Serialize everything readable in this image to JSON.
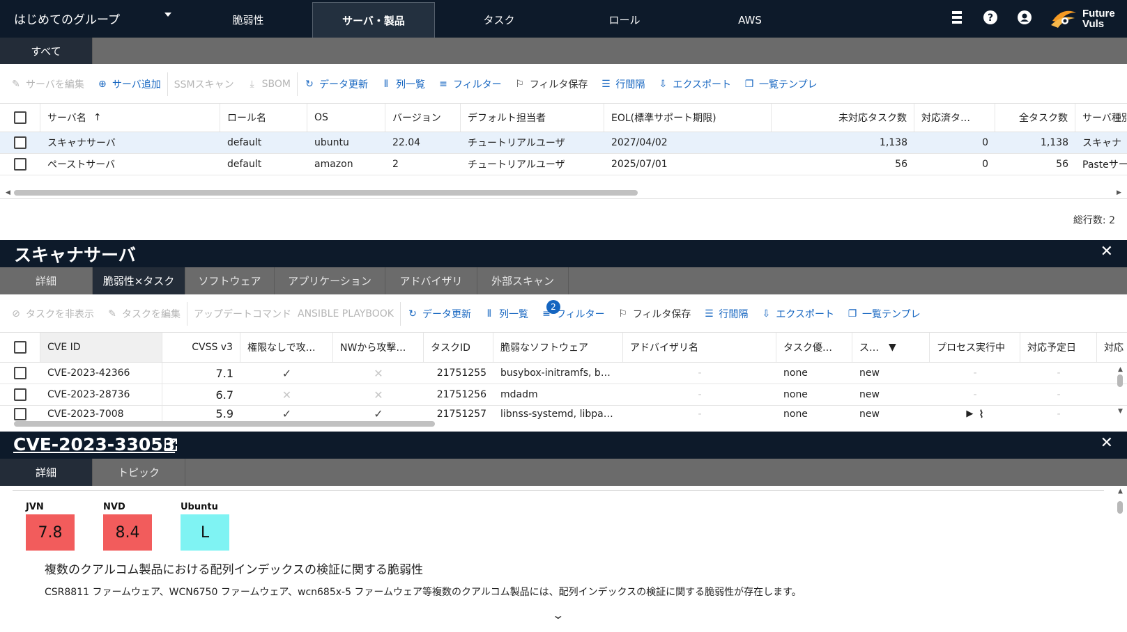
{
  "topnav": {
    "group_name": "はじめてのグループ",
    "tabs": [
      "脆弱性",
      "サーバ・製品",
      "タスク",
      "ロール",
      "AWS"
    ],
    "active_tab": "サーバ・製品",
    "logo_line1": "Future",
    "logo_line2": "Vuls"
  },
  "server_section": {
    "subtab": "すべて",
    "toolbar": {
      "edit": "サーバを編集",
      "add": "サーバ追加",
      "ssm": "SSMスキャン",
      "sbom": "SBOM",
      "refresh": "データ更新",
      "columns": "列一覧",
      "filter": "フィルター",
      "save_filter": "フィルタ保存",
      "row_spacing": "行間隔",
      "export": "エクスポート",
      "template": "一覧テンプレ"
    },
    "columns": [
      "サーバ名",
      "ロール名",
      "OS",
      "バージョン",
      "デフォルト担当者",
      "EOL(標準サポート期限)",
      "未対応タスク数",
      "対応済タ…",
      "全タスク数",
      "サーバ種別"
    ],
    "rows": [
      [
        "スキャナサーバ",
        "default",
        "ubuntu",
        "22.04",
        "チュートリアルユーザ",
        "2027/04/02",
        "1,138",
        "0",
        "1,138",
        "スキャナ"
      ],
      [
        "ペーストサーバ",
        "default",
        "amazon",
        "2",
        "チュートリアルユーザ",
        "2025/07/01",
        "56",
        "0",
        "56",
        "Pasteサー"
      ]
    ],
    "total_rows": "総行数: 2"
  },
  "task_section": {
    "title": "スキャナサーバ",
    "tabs": [
      "詳細",
      "脆弱性×タスク",
      "ソフトウェア",
      "アプリケーション",
      "アドバイザリ",
      "外部スキャン"
    ],
    "active_tab": "脆弱性×タスク",
    "toolbar": {
      "hide": "タスクを非表示",
      "edit": "タスクを編集",
      "update_cmd": "アップデートコマンド",
      "ansible": "ANSIBLE PLAYBOOK",
      "refresh": "データ更新",
      "columns": "列一覧",
      "filter": "フィルター",
      "filter_count": "2",
      "save_filter": "フィルタ保存",
      "row_spacing": "行間隔",
      "export": "エクスポート",
      "template": "一覧テンプレ"
    },
    "columns": [
      "CVE ID",
      "CVSS v3",
      "権限なしで攻…",
      "NWから攻撃…",
      "タスクID",
      "脆弱なソフトウェア",
      "アドバイザリ名",
      "タスク優…",
      "ス…",
      "プロセス実行中",
      "対応予定日",
      "対応"
    ],
    "rows": [
      {
        "cve": "CVE-2023-42366",
        "cvss": "7.1",
        "priv": "check",
        "nw": "cross",
        "task": "21751255",
        "sw": "busybox-initramfs, b…",
        "adv": "-",
        "prio": "none",
        "status": "new",
        "proc": "-",
        "due": "-"
      },
      {
        "cve": "CVE-2023-28736",
        "cvss": "6.7",
        "priv": "cross",
        "nw": "cross",
        "task": "21751256",
        "sw": "mdadm",
        "adv": "-",
        "prio": "none",
        "status": "new",
        "proc": "-",
        "due": "-"
      },
      {
        "cve": "CVE-2023-7008",
        "cvss": "5.9",
        "priv": "check",
        "nw": "check",
        "task": "21751257",
        "sw": "libnss-systemd, libpa…",
        "adv": "-",
        "prio": "none",
        "status": "new",
        "proc": "running",
        "due": "-"
      }
    ]
  },
  "cve_section": {
    "title": "CVE-2023-33053",
    "tabs": [
      "詳細",
      "トピック"
    ],
    "active_tab": "詳細",
    "scores": [
      {
        "source": "JVN",
        "value": "7.8",
        "color": "#f25c5c"
      },
      {
        "source": "NVD",
        "value": "8.4",
        "color": "#f25c5c"
      },
      {
        "source": "Ubuntu",
        "value": "L",
        "color": "#7ff3f3"
      }
    ],
    "summary_title": "複数のクアルコム製品における配列インデックスの検証に関する脆弱性",
    "summary_body": "CSR8811 ファームウェア、WCN6750 ファームウェア、wcn685x-5 ファームウェア等複数のクアルコム製品には、配列インデックスの検証に関する脆弱性が存在します。"
  }
}
